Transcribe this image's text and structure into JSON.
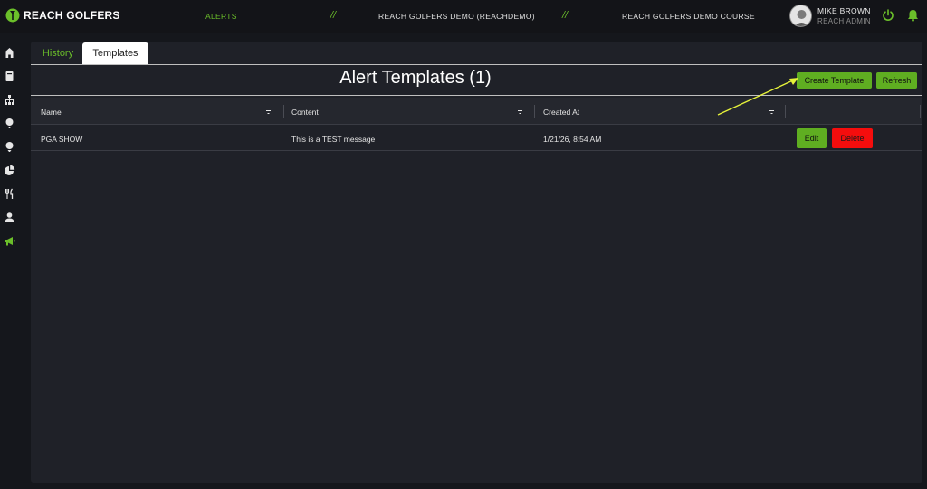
{
  "header": {
    "brand": "REACH GOLFERS",
    "nav_alerts": "ALERTS",
    "separator": "//",
    "org": "REACH GOLFERS DEMO (REACHDEMO)",
    "course": "REACH GOLFERS DEMO COURSE",
    "user_name": "MIKE BROWN",
    "user_role": "REACH ADMIN"
  },
  "sidebar": {
    "icons": [
      "home-icon",
      "book-icon",
      "org-chart-icon",
      "golf-ball-icon",
      "golf-ball-tee-icon",
      "chart-pie-icon",
      "utensils-icon",
      "user-icon",
      "megaphone-icon"
    ],
    "active": "megaphone-icon"
  },
  "tabs": [
    {
      "label": "History",
      "active": false
    },
    {
      "label": "Templates",
      "active": true
    }
  ],
  "page": {
    "title": "Alert Templates (1)",
    "create_label": "Create Template",
    "refresh_label": "Refresh"
  },
  "table": {
    "columns": [
      "Name",
      "Content",
      "Created At",
      ""
    ],
    "rows": [
      {
        "name": "PGA SHOW",
        "content": "This is a TEST message",
        "created_at": "1/21/26, 8:54 AM",
        "edit_label": "Edit",
        "delete_label": "Delete"
      }
    ]
  },
  "colors": {
    "accent": "#6bbf2a",
    "button_green": "#5fae21",
    "danger": "#f50d0d",
    "annotation_arrow": "#e6f23a"
  }
}
